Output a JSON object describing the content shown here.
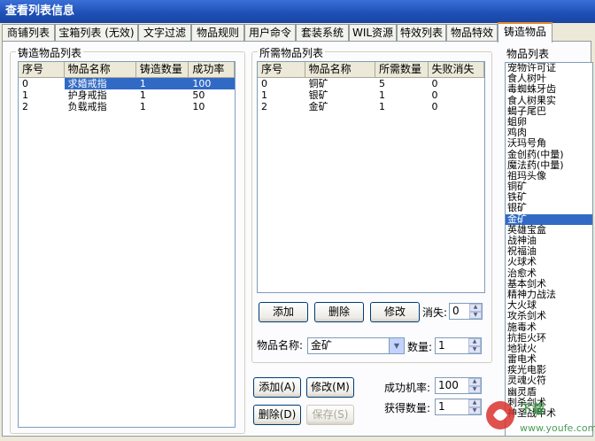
{
  "window": {
    "title": "查看列表信息"
  },
  "tabs": [
    "商铺列表",
    "宝箱列表 (无效)",
    "文字过滤",
    "物品规则",
    "用户命令",
    "套装系统",
    "WIL资源",
    "特效列表",
    "物品特效",
    "铸造物品"
  ],
  "active_tab": "铸造物品",
  "forge_list": {
    "label": "铸造物品列表",
    "columns": [
      "序号",
      "物品名称",
      "铸造数量",
      "成功率"
    ],
    "rows": [
      [
        "0",
        "求婚戒指",
        "1",
        "100"
      ],
      [
        "1",
        "护身戒指",
        "1",
        "50"
      ],
      [
        "2",
        "负载戒指",
        "1",
        "10"
      ]
    ]
  },
  "required_list": {
    "label": "所需物品列表",
    "columns": [
      "序号",
      "物品名称",
      "所需数量",
      "失败消失"
    ],
    "rows": [
      [
        "0",
        "铜矿",
        "5",
        "0"
      ],
      [
        "1",
        "银矿",
        "1",
        "0"
      ],
      [
        "2",
        "金矿",
        "1",
        "0"
      ]
    ],
    "add_label": "添加",
    "delete_label": "删除",
    "modify_label": "修改",
    "vanish_label": "消失:",
    "vanish_value": "0",
    "item_name_label": "物品名称:",
    "item_name_value": "金矿",
    "qty_label": "数量:",
    "qty_value": "1"
  },
  "forge_actions": {
    "add_label": "添加(A)",
    "modify_label": "修改(M)",
    "delete_label": "删除(D)",
    "save_label": "保存(S)",
    "rate_label": "成功机率:",
    "rate_value": "100",
    "obtain_label": "获得数量:",
    "obtain_value": "1"
  },
  "item_list": {
    "label": "物品列表",
    "items": [
      "宠物许可证",
      "食人树叶",
      "毒蜘蛛牙齿",
      "食人树果实",
      "蝎子尾巴",
      "蛆卵",
      "鸡肉",
      "沃玛号角",
      "金创药(中量)",
      "魔法药(中量)",
      "祖玛头像",
      "铜矿",
      "铁矿",
      "银矿",
      "金矿",
      "英雄宝盒",
      "战神油",
      "祝福油",
      "火球术",
      "治愈术",
      "基本剑术",
      "精神力战法",
      "大火球",
      "攻杀剑术",
      "施毒术",
      "抗拒火环",
      "地狱火",
      "雷电术",
      "疾光电影",
      "灵魂火符",
      "幽灵盾",
      "刺杀剑术",
      "神圣战甲术"
    ],
    "selected": "金矿"
  },
  "watermark": {
    "text": "下载",
    "site": "www.youfe.com"
  }
}
